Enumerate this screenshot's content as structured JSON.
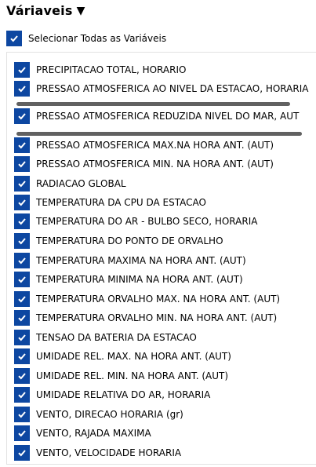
{
  "header": {
    "title": "Váriaveis",
    "caret": "▼"
  },
  "select_all": {
    "label": "Selecionar Todas as Variáveis",
    "checked": true
  },
  "variables": [
    {
      "label": "PRECIPITACAO TOTAL, HORARIO",
      "checked": true
    },
    {
      "label": "PRESSAO ATMOSFERICA AO NIVEL DA ESTACAO, HORARIA",
      "checked": true
    },
    {
      "label": "PRESSAO ATMOSFERICA REDUZIDA NIVEL DO MAR, AUT",
      "checked": true
    },
    {
      "label": "PRESSAO ATMOSFERICA MAX.NA HORA ANT. (AUT)",
      "checked": true
    },
    {
      "label": "PRESSAO ATMOSFERICA MIN. NA HORA ANT. (AUT)",
      "checked": true
    },
    {
      "label": "RADIACAO GLOBAL",
      "checked": true
    },
    {
      "label": "TEMPERATURA DA CPU DA ESTACAO",
      "checked": true
    },
    {
      "label": "TEMPERATURA DO AR - BULBO SECO, HORARIA",
      "checked": true
    },
    {
      "label": "TEMPERATURA DO PONTO DE ORVALHO",
      "checked": true
    },
    {
      "label": "TEMPERATURA MAXIMA NA HORA ANT. (AUT)",
      "checked": true
    },
    {
      "label": "TEMPERATURA MINIMA NA HORA ANT. (AUT)",
      "checked": true
    },
    {
      "label": "TEMPERATURA ORVALHO MAX. NA HORA ANT. (AUT)",
      "checked": true
    },
    {
      "label": "TEMPERATURA ORVALHO MIN. NA HORA ANT. (AUT)",
      "checked": true
    },
    {
      "label": "TENSAO DA BATERIA DA ESTACAO",
      "checked": true
    },
    {
      "label": "UMIDADE REL. MAX. NA HORA ANT. (AUT)",
      "checked": true
    },
    {
      "label": "UMIDADE REL. MIN. NA HORA ANT. (AUT)",
      "checked": true
    },
    {
      "label": "UMIDADE RELATIVA DO AR, HORARIA",
      "checked": true
    },
    {
      "label": "VENTO, DIRECAO HORARIA (gr)",
      "checked": true
    },
    {
      "label": "VENTO, RAJADA MAXIMA",
      "checked": true
    },
    {
      "label": "VENTO, VELOCIDADE HORARIA",
      "checked": true
    }
  ],
  "icons": {
    "check": "checkmark-icon",
    "caret": "caret-down-icon"
  },
  "colors": {
    "checkbox": "#0d47a1",
    "drag_bar": "#616161"
  }
}
